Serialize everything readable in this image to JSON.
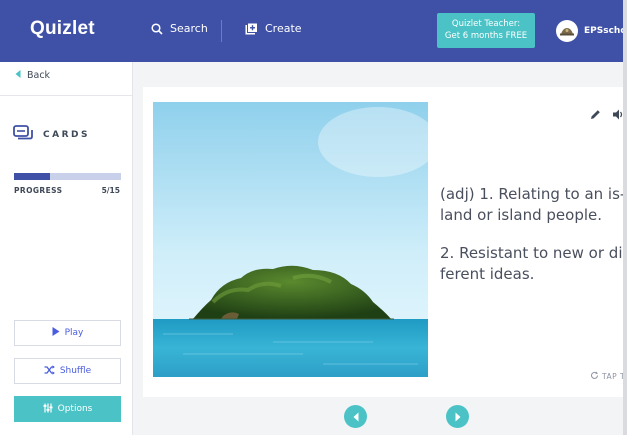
{
  "header": {
    "logo": "Quizlet",
    "search_label": "Search",
    "create_label": "Create",
    "promo_line1": "Quizlet Teacher:",
    "promo_line2": "Get 6 months FREE",
    "username": "EPSschoo"
  },
  "sidebar": {
    "back_label": "Back",
    "mode_label": "CARDS",
    "progress_label": "PROGRESS",
    "progress_count": "5/15",
    "progress_value": 5,
    "progress_total": 15,
    "play_label": "Play",
    "shuffle_label": "Shuffle",
    "options_label": "Options"
  },
  "card": {
    "definition_line1a": "(adj) 1. Relating to an is-",
    "definition_line1b": "land or island people.",
    "definition_line2a": "2. Resistant to new or di",
    "definition_line2b": "ferent ideas.",
    "tap_hint": "TAP T"
  },
  "colors": {
    "brand": "#3f51a6",
    "accent": "#4bc3c6",
    "link": "#4a5de0"
  },
  "icons": {
    "search": "search-icon",
    "create": "create-icon",
    "back": "back-arrow-icon",
    "cards": "cards-icon",
    "play": "play-icon",
    "shuffle": "shuffle-icon",
    "options": "options-icon",
    "edit": "pencil-icon",
    "audio": "speaker-icon",
    "flip": "flip-icon",
    "prev": "arrow-left-icon",
    "next": "arrow-right-icon"
  }
}
